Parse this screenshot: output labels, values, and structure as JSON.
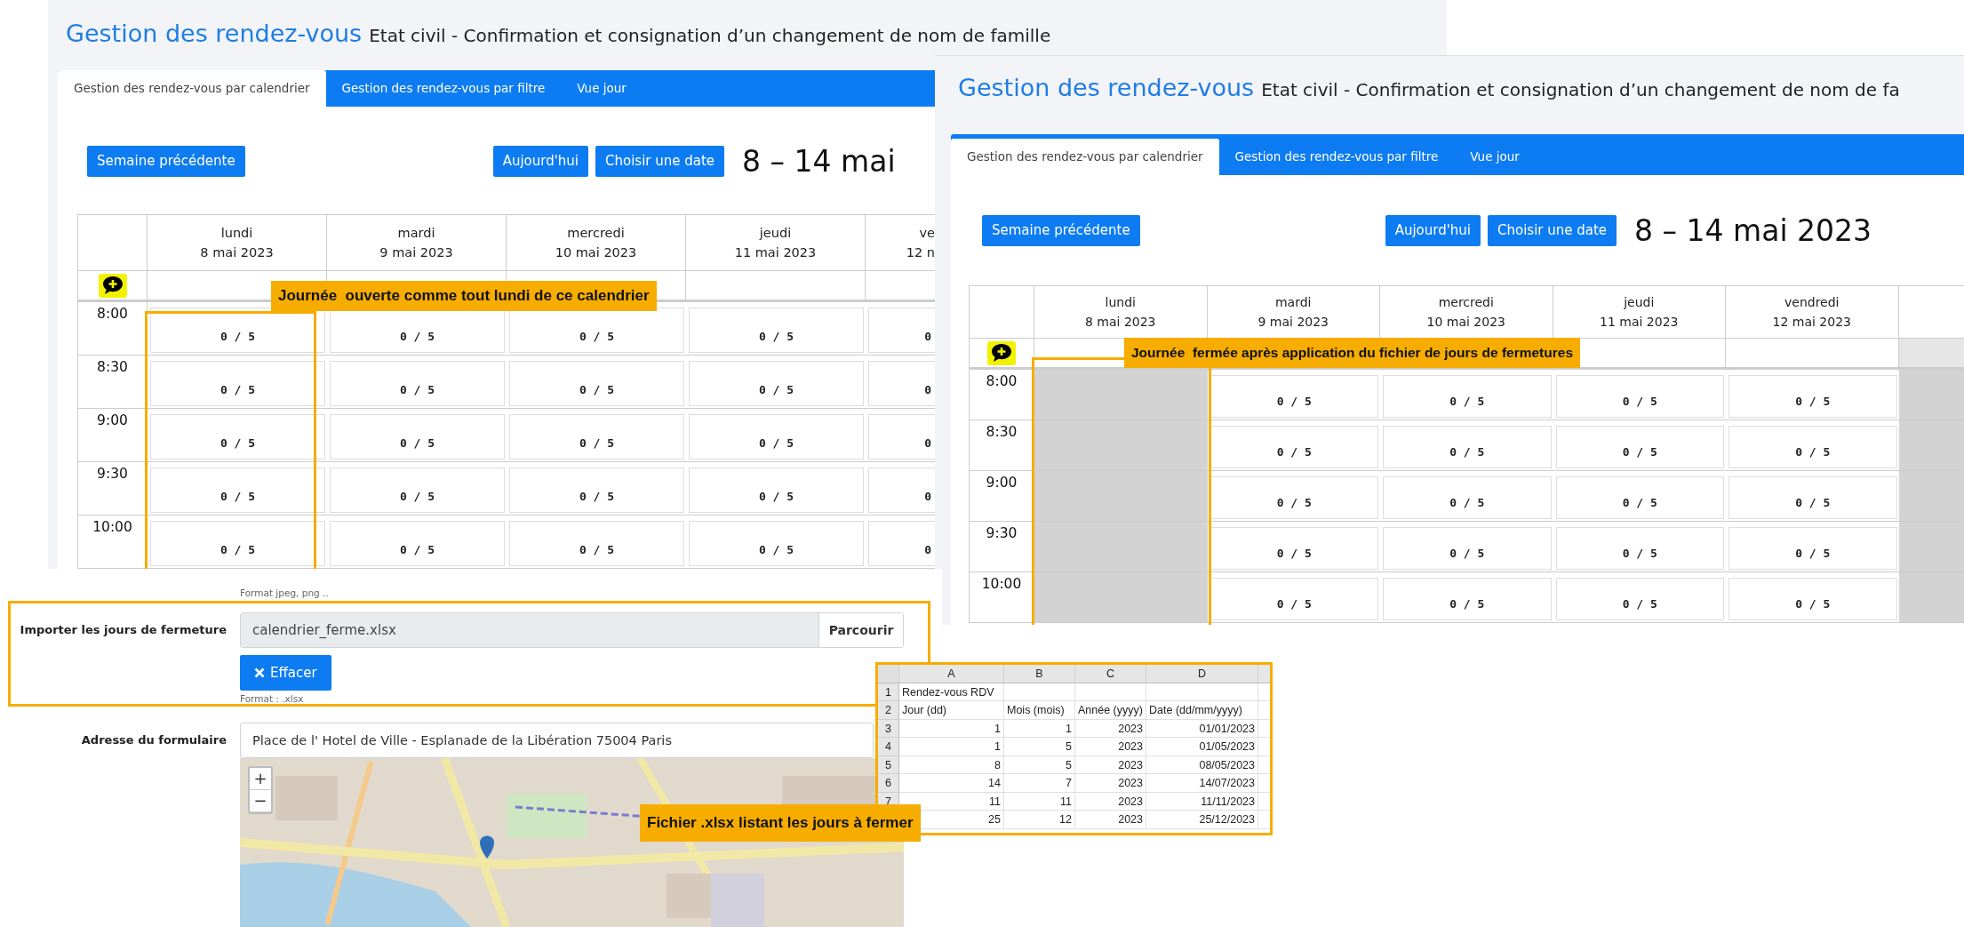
{
  "panels": [
    {
      "title": "Gestion des rendez-vous",
      "subtitle": "Etat civil - Confirmation et consignation d’un changement de nom de famille",
      "tabs": [
        {
          "label": "Gestion des rendez-vous par calendrier",
          "selected": true
        },
        {
          "label": "Gestion des rendez-vous par filtre",
          "selected": false
        },
        {
          "label": "Vue jour",
          "selected": false
        }
      ],
      "toolbar": {
        "previous": "Semaine précédente",
        "today": "Aujourd'hui",
        "choose": "Choisir une date",
        "range": "8 – 14 mai"
      },
      "columns": [
        {
          "day": "lundi",
          "date": "8 mai 2023",
          "closed": false
        },
        {
          "day": "mardi",
          "date": "9 mai 2023",
          "closed": false
        },
        {
          "day": "mercredi",
          "date": "10 mai 2023",
          "closed": false
        },
        {
          "day": "jeudi",
          "date": "11 mai 2023",
          "closed": false
        },
        {
          "day": "ve",
          "date": "12 n",
          "closed": false
        }
      ],
      "slots": [
        {
          "time": "8:00",
          "cells": [
            {
              "count": "0 / 5",
              "closed": false
            },
            {
              "count": "0 / 5",
              "closed": false
            },
            {
              "count": "0 / 5",
              "closed": false
            },
            {
              "count": "0 / 5",
              "closed": false
            },
            {
              "count": "0",
              "closed": false
            }
          ]
        },
        {
          "time": "8:30",
          "cells": [
            {
              "count": "0 / 5",
              "closed": false
            },
            {
              "count": "0 / 5",
              "closed": false
            },
            {
              "count": "0 / 5",
              "closed": false
            },
            {
              "count": "0 / 5",
              "closed": false
            },
            {
              "count": "0",
              "closed": false
            }
          ]
        },
        {
          "time": "9:00",
          "cells": [
            {
              "count": "0 / 5",
              "closed": false
            },
            {
              "count": "0 / 5",
              "closed": false
            },
            {
              "count": "0 / 5",
              "closed": false
            },
            {
              "count": "0 / 5",
              "closed": false
            },
            {
              "count": "0",
              "closed": false
            }
          ]
        },
        {
          "time": "9:30",
          "cells": [
            {
              "count": "0 / 5",
              "closed": false
            },
            {
              "count": "0 / 5",
              "closed": false
            },
            {
              "count": "0 / 5",
              "closed": false
            },
            {
              "count": "0 / 5",
              "closed": false
            },
            {
              "count": "0",
              "closed": false
            }
          ]
        },
        {
          "time": "10:00",
          "cells": [
            {
              "count": "0 / 5",
              "closed": false
            },
            {
              "count": "0 / 5",
              "closed": false
            },
            {
              "count": "0 / 5",
              "closed": false
            },
            {
              "count": "0 / 5",
              "closed": false
            },
            {
              "count": "0",
              "closed": false
            }
          ]
        }
      ]
    },
    {
      "title": "Gestion des rendez-vous",
      "subtitle": "Etat civil - Confirmation et consignation d’un changement de nom de fa",
      "tabs": [
        {
          "label": "Gestion des rendez-vous par calendrier",
          "selected": true
        },
        {
          "label": "Gestion des rendez-vous par filtre",
          "selected": false
        },
        {
          "label": "Vue jour",
          "selected": false
        }
      ],
      "toolbar": {
        "previous": "Semaine précédente",
        "today": "Aujourd'hui",
        "choose": "Choisir une date",
        "range": "8 – 14 mai 2023"
      },
      "columns": [
        {
          "day": "lundi",
          "date": "8 mai 2023",
          "closed": false
        },
        {
          "day": "mardi",
          "date": "9 mai 2023",
          "closed": false
        },
        {
          "day": "mercredi",
          "date": "10 mai 2023",
          "closed": false
        },
        {
          "day": "jeudi",
          "date": "11 mai 2023",
          "closed": false
        },
        {
          "day": "vendredi",
          "date": "12 mai 2023",
          "closed": false
        },
        {
          "closed": true
        }
      ],
      "slots": [
        {
          "time": "8:00",
          "cells": [
            {
              "closed": true
            },
            {
              "count": "0 / 5",
              "closed": false
            },
            {
              "count": "0 / 5",
              "closed": false
            },
            {
              "count": "0 / 5",
              "closed": false
            },
            {
              "count": "0 / 5",
              "closed": false
            },
            {
              "closed": true
            }
          ]
        },
        {
          "time": "8:30",
          "cells": [
            {
              "closed": true
            },
            {
              "count": "0 / 5",
              "closed": false
            },
            {
              "count": "0 / 5",
              "closed": false
            },
            {
              "count": "0 / 5",
              "closed": false
            },
            {
              "count": "0 / 5",
              "closed": false
            },
            {
              "closed": true
            }
          ]
        },
        {
          "time": "9:00",
          "cells": [
            {
              "closed": true
            },
            {
              "count": "0 / 5",
              "closed": false
            },
            {
              "count": "0 / 5",
              "closed": false
            },
            {
              "count": "0 / 5",
              "closed": false
            },
            {
              "count": "0 / 5",
              "closed": false
            },
            {
              "closed": true
            }
          ]
        },
        {
          "time": "9:30",
          "cells": [
            {
              "closed": true
            },
            {
              "count": "0 / 5",
              "closed": false
            },
            {
              "count": "0 / 5",
              "closed": false
            },
            {
              "count": "0 / 5",
              "closed": false
            },
            {
              "count": "0 / 5",
              "closed": false
            },
            {
              "closed": true
            }
          ]
        },
        {
          "time": "10:00",
          "cells": [
            {
              "closed": true
            },
            {
              "count": "0 / 5",
              "closed": false
            },
            {
              "count": "0 / 5",
              "closed": false
            },
            {
              "count": "0 / 5",
              "closed": false
            },
            {
              "count": "0 / 5",
              "closed": false
            },
            {
              "closed": true
            }
          ]
        }
      ]
    }
  ],
  "form": {
    "hint": "Format jpeg, png ..",
    "import": {
      "label": "Importer les jours de fermeture",
      "value": "calendrier_ferme.xlsx",
      "browse": "Parcourir",
      "clear": "Effacer",
      "hint": "Format : .xlsx"
    },
    "address": {
      "label": "Adresse du formulaire",
      "value": "Place de l' Hotel de Ville - Esplanade de la Libération 75004 Paris"
    },
    "map": {
      "kind": "picture",
      "zoom_controls": [
        "+",
        "−"
      ]
    }
  },
  "spreadsheet": {
    "columns": [
      "A",
      "B",
      "C",
      "D"
    ],
    "rows": [
      {
        "number": "1",
        "kind": "header",
        "cells": [
          "Rendez-vous RDV"
        ]
      },
      {
        "number": "2",
        "kind": "header",
        "cells": [
          "Jour (dd)",
          "Mois (mois)",
          "Année (yyyy)",
          "Date (dd/mm/yyyy)"
        ]
      },
      {
        "number": "3",
        "kind": "data",
        "cells": [
          "1",
          "1",
          "2023",
          "01/01/2023"
        ]
      },
      {
        "number": "4",
        "kind": "data",
        "cells": [
          "1",
          "5",
          "2023",
          "01/05/2023"
        ]
      },
      {
        "number": "5",
        "kind": "data",
        "cells": [
          "8",
          "5",
          "2023",
          "08/05/2023"
        ]
      },
      {
        "number": "6",
        "kind": "data",
        "cells": [
          "14",
          "7",
          "2023",
          "14/07/2023"
        ]
      },
      {
        "number": "7",
        "kind": "data",
        "cells": [
          "11",
          "11",
          "2023",
          "11/11/2023"
        ]
      },
      {
        "kind": "data",
        "cells": [
          "25",
          "12",
          "2023",
          "25/12/2023"
        ]
      }
    ]
  },
  "callouts": [
    "Journée  ouverte comme tout lundi de ce calendrier",
    "Journée  fermée après application du fichier de jours de fermetures",
    "Fichier .xlsx listant les jours à fermer"
  ]
}
